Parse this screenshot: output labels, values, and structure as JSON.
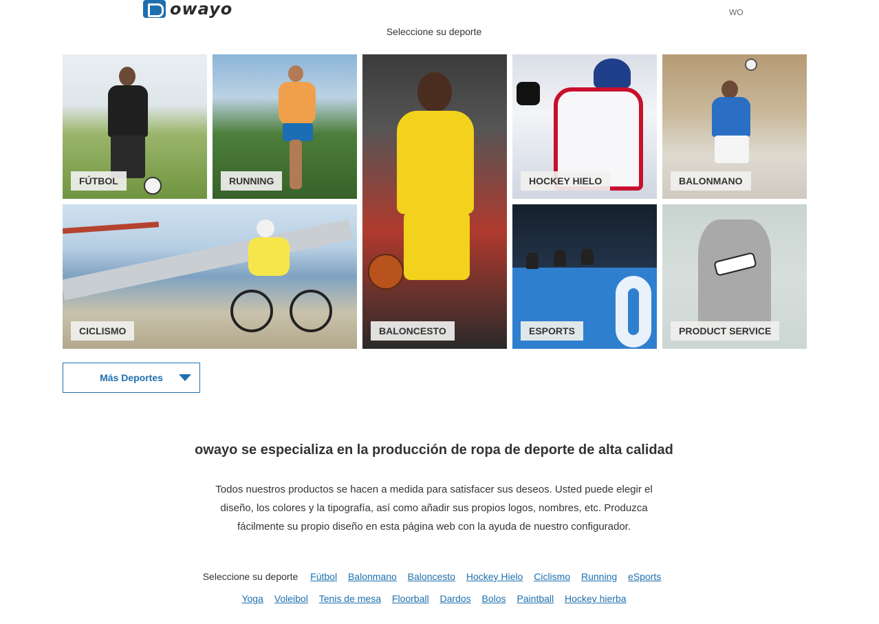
{
  "header": {
    "logo_text": "owayo",
    "region": "WO"
  },
  "select_title": "Seleccione su deporte",
  "tiles": [
    {
      "label": "FÚTBOL"
    },
    {
      "label": "RUNNING"
    },
    {
      "label": "BALONCESTO"
    },
    {
      "label": "HOCKEY HIELO"
    },
    {
      "label": "BALONMANO"
    },
    {
      "label": "CICLISMO"
    },
    {
      "label": "ESPORTS"
    },
    {
      "label": "PRODUCT SERVICE"
    }
  ],
  "more_button": {
    "label": "Más Deportes"
  },
  "headline": "owayo se especializa en la producción de ropa de deporte de alta calidad",
  "description": "Todos nuestros productos se hacen a medida para satisfacer sus deseos. Usted puede elegir el diseño, los colores y la tipografía, así como añadir sus propios logos, nombres, etc. Produzca fácilmente su propio diseño en esta página web con la ayuda de nuestro configurador.",
  "sport_links": {
    "label": "Seleccione su deporte",
    "row1": [
      "Fútbol",
      "Balonmano",
      "Baloncesto",
      "Hockey Hielo",
      "Ciclismo",
      "Running",
      "eSports"
    ],
    "row2": [
      "Yoga",
      "Voleibol",
      "Tenis de mesa",
      "Floorball",
      "Dardos",
      "Bolos",
      "Paintball",
      "Hockey hierba"
    ]
  },
  "colors": {
    "brand": "#1d6fae",
    "text": "#333333",
    "label_bg": "#f0f0ee"
  }
}
